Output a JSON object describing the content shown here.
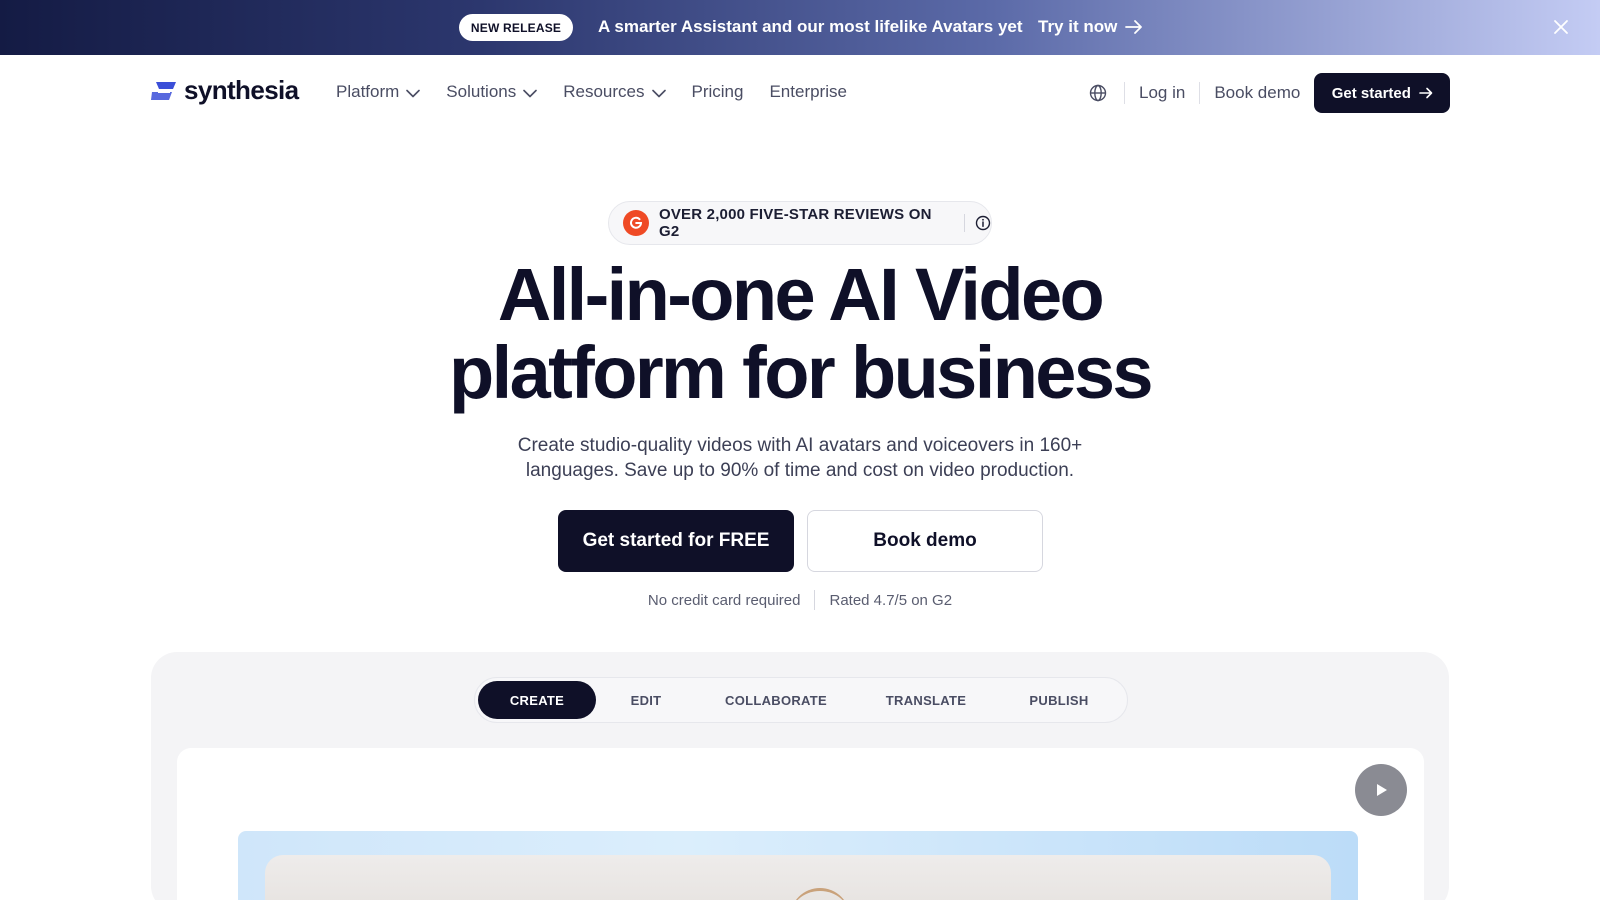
{
  "promo": {
    "pill": "NEW RELEASE",
    "message": "A smarter Assistant and our most lifelike Avatars yet",
    "cta": "Try it now"
  },
  "nav": {
    "brand": "synthesia",
    "links": [
      {
        "label": "Platform",
        "has_dropdown": true
      },
      {
        "label": "Solutions",
        "has_dropdown": true
      },
      {
        "label": "Resources",
        "has_dropdown": true
      },
      {
        "label": "Pricing",
        "has_dropdown": false
      },
      {
        "label": "Enterprise",
        "has_dropdown": false
      }
    ],
    "login": "Log in",
    "book_demo": "Book demo",
    "get_started": "Get started"
  },
  "hero": {
    "badge": "OVER 2,000 FIVE-STAR REVIEWS ON G2",
    "headline_line1": "All-in-one AI Video",
    "headline_line2": "platform for business",
    "subtitle": "Create studio-quality videos with AI avatars and voiceovers in 160+ languages. Save up to 90% of time and cost on video production.",
    "cta_primary": "Get started for FREE",
    "cta_secondary": "Book demo",
    "meta_left": "No credit card required",
    "meta_right": "Rated 4.7/5 on G2"
  },
  "demo": {
    "tabs": [
      "CREATE",
      "EDIT",
      "COLLABORATE",
      "TRANSLATE",
      "PUBLISH"
    ],
    "active_tab": "CREATE"
  },
  "colors": {
    "brand_dark": "#0f1028",
    "brand_blue": "#3b4fd8",
    "g2_red": "#ef4a25"
  },
  "icons": [
    "close-icon",
    "arrow-right-icon",
    "chevron-down-icon",
    "globe-icon",
    "info-icon",
    "play-icon",
    "g2-logo-icon"
  ]
}
